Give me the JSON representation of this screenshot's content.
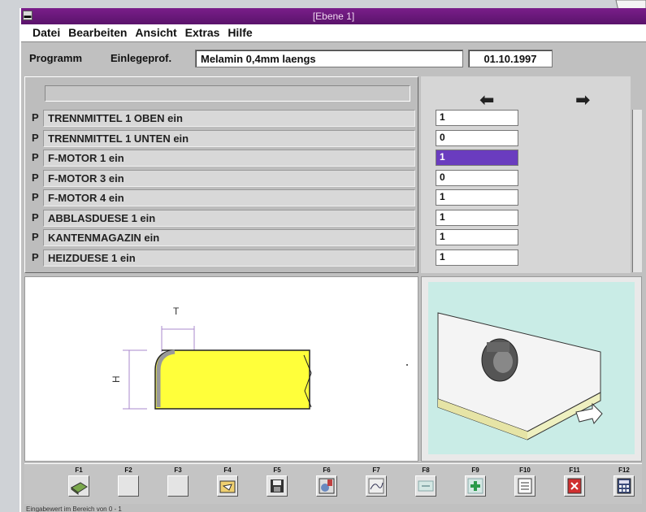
{
  "window": {
    "title": "[Ebene 1]"
  },
  "menu": [
    "Datei",
    "Bearbeiten",
    "Ansicht",
    "Extras",
    "Hilfe"
  ],
  "program": {
    "label": "Programm",
    "type": "Einlegeprof.",
    "name": "Melamin 0,4mm laengs",
    "date": "01.10.1997"
  },
  "rows": [
    {
      "prefix": "P",
      "label": "TRENNMITTEL 1 OBEN    ein",
      "value": "1",
      "selected": false
    },
    {
      "prefix": "P",
      "label": "TRENNMITTEL 1 UNTEN    ein",
      "value": "0",
      "selected": false
    },
    {
      "prefix": "P",
      "label": "F-MOTOR 1    ein",
      "value": "1",
      "selected": true
    },
    {
      "prefix": "P",
      "label": "F-MOTOR 3    ein",
      "value": "0",
      "selected": false
    },
    {
      "prefix": "P",
      "label": "F-MOTOR 4    ein",
      "value": "1",
      "selected": false
    },
    {
      "prefix": "P",
      "label": "ABBLASDUESE 1    ein",
      "value": "1",
      "selected": false
    },
    {
      "prefix": "P",
      "label": "KANTENMAGAZIN    ein",
      "value": "1",
      "selected": false
    },
    {
      "prefix": "P",
      "label": "HEIZDUESE 1    ein",
      "value": "1",
      "selected": false
    }
  ],
  "drawing": {
    "dim_t": "T",
    "dim_h": "H"
  },
  "fkeys": [
    {
      "label": "F1",
      "icon": "book-icon"
    },
    {
      "label": "F2",
      "icon": "empty"
    },
    {
      "label": "F3",
      "icon": "empty"
    },
    {
      "label": "F4",
      "icon": "folder-open-icon"
    },
    {
      "label": "F5",
      "icon": "floppy-save-icon"
    },
    {
      "label": "F6",
      "icon": "tool-settings-icon"
    },
    {
      "label": "F7",
      "icon": "edit-curve-icon"
    },
    {
      "label": "F8",
      "icon": "minus-icon"
    },
    {
      "label": "F9",
      "icon": "plus-icon"
    },
    {
      "label": "F10",
      "icon": "document-list-icon"
    },
    {
      "label": "F11",
      "icon": "exit-icon"
    },
    {
      "label": "F12",
      "icon": "calculator-icon"
    }
  ],
  "status": "Eingabewert im Bereich von 0 - 1",
  "colors": {
    "titlebar": "#6b1a7c",
    "selected_value": "#6a3cbf",
    "profile_fill": "#ffff3a",
    "image_bg": "#c9ece6"
  }
}
